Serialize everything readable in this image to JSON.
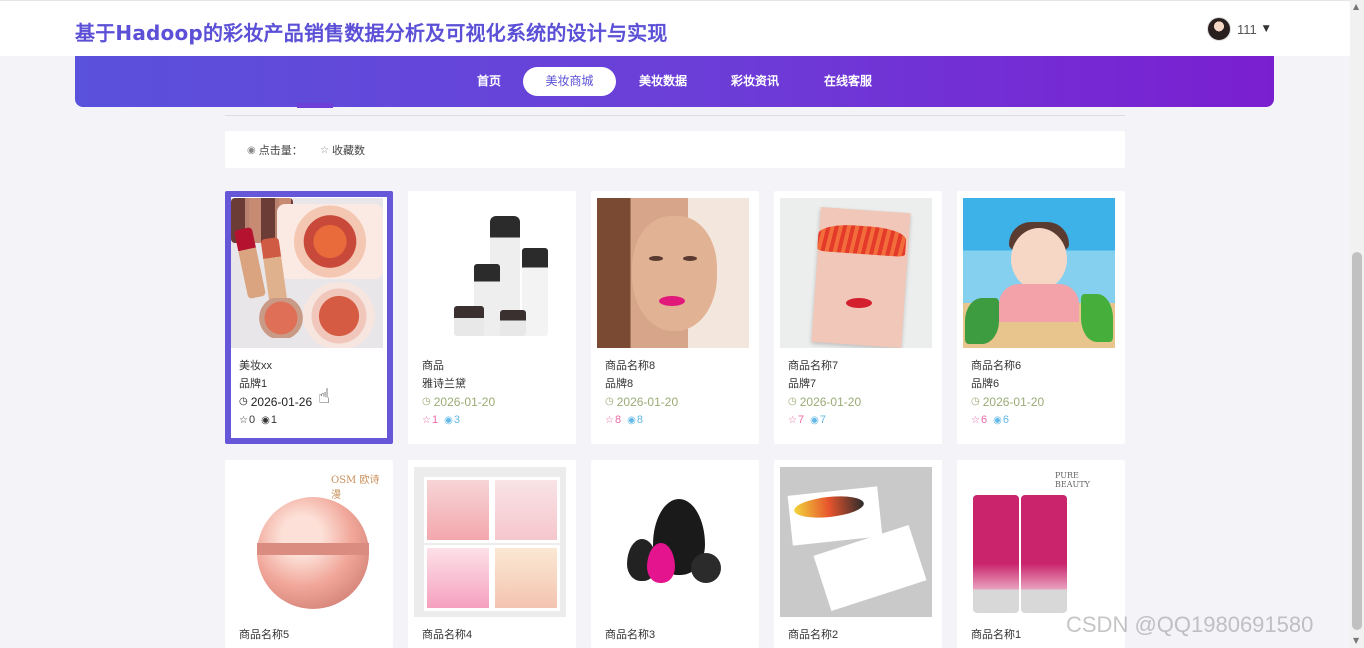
{
  "header": {
    "title": "基于Hadoop的彩妆产品销售数据分析及可视化系统的设计与实现",
    "username": "111"
  },
  "nav": {
    "items": [
      "首页",
      "美妆商城",
      "美妆数据",
      "彩妆资讯",
      "在线客服"
    ],
    "active_index": 1
  },
  "filters": {
    "clicks_label": "点击量：",
    "favorites_label": "收藏数"
  },
  "products": [
    {
      "name": "美妆xx",
      "brand": "品牌1",
      "date": "2026-01-26",
      "favorites": "0",
      "views": "1",
      "image": "makeup-palette-lipsticks",
      "selected": true
    },
    {
      "name": "商品",
      "brand": "雅诗兰黛",
      "date": "2026-01-20",
      "favorites": "1",
      "views": "3",
      "image": "skincare-bottles"
    },
    {
      "name": "商品名称8",
      "brand": "品牌8",
      "date": "2026-01-20",
      "favorites": "8",
      "views": "8",
      "image": "woman-face-pink-lips"
    },
    {
      "name": "商品名称7",
      "brand": "品牌7",
      "date": "2026-01-20",
      "favorites": "7",
      "views": "7",
      "image": "red-lashes-makeup-art"
    },
    {
      "name": "商品名称6",
      "brand": "品牌6",
      "date": "2026-01-20",
      "favorites": "6",
      "views": "6",
      "image": "illustrated-girl-flowers"
    },
    {
      "name": "商品名称5",
      "brand": "",
      "date": "",
      "favorites": "",
      "views": "",
      "image": "osm-pearl-cream-jar",
      "logo": "OSM 欧诗漫"
    },
    {
      "name": "商品名称4",
      "brand": "",
      "date": "",
      "favorites": "",
      "views": "",
      "image": "cosmetics-collage"
    },
    {
      "name": "商品名称3",
      "brand": "",
      "date": "",
      "favorites": "",
      "views": "",
      "image": "beauty-blender-sponges"
    },
    {
      "name": "商品名称2",
      "brand": "",
      "date": "",
      "favorites": "",
      "views": "",
      "image": "makeup-brush-business-cards"
    },
    {
      "name": "商品名称1",
      "brand": "",
      "date": "",
      "favorites": "",
      "views": "",
      "image": "bb-cream-tubes",
      "logo": "PURE BEAUTY"
    }
  ],
  "watermark": "CSDN @QQ1980691580",
  "colors": {
    "brand": "#5b50d6",
    "nav_start": "#5a51dc",
    "nav_end": "#7a1fd0",
    "selected_border": "#6656d8",
    "favorite": "#ee6aa7",
    "views": "#62b8e6",
    "date": "#9aab76"
  },
  "icons": {
    "clicks": "eye-icon",
    "favorites": "star-icon",
    "date": "clock-icon"
  }
}
